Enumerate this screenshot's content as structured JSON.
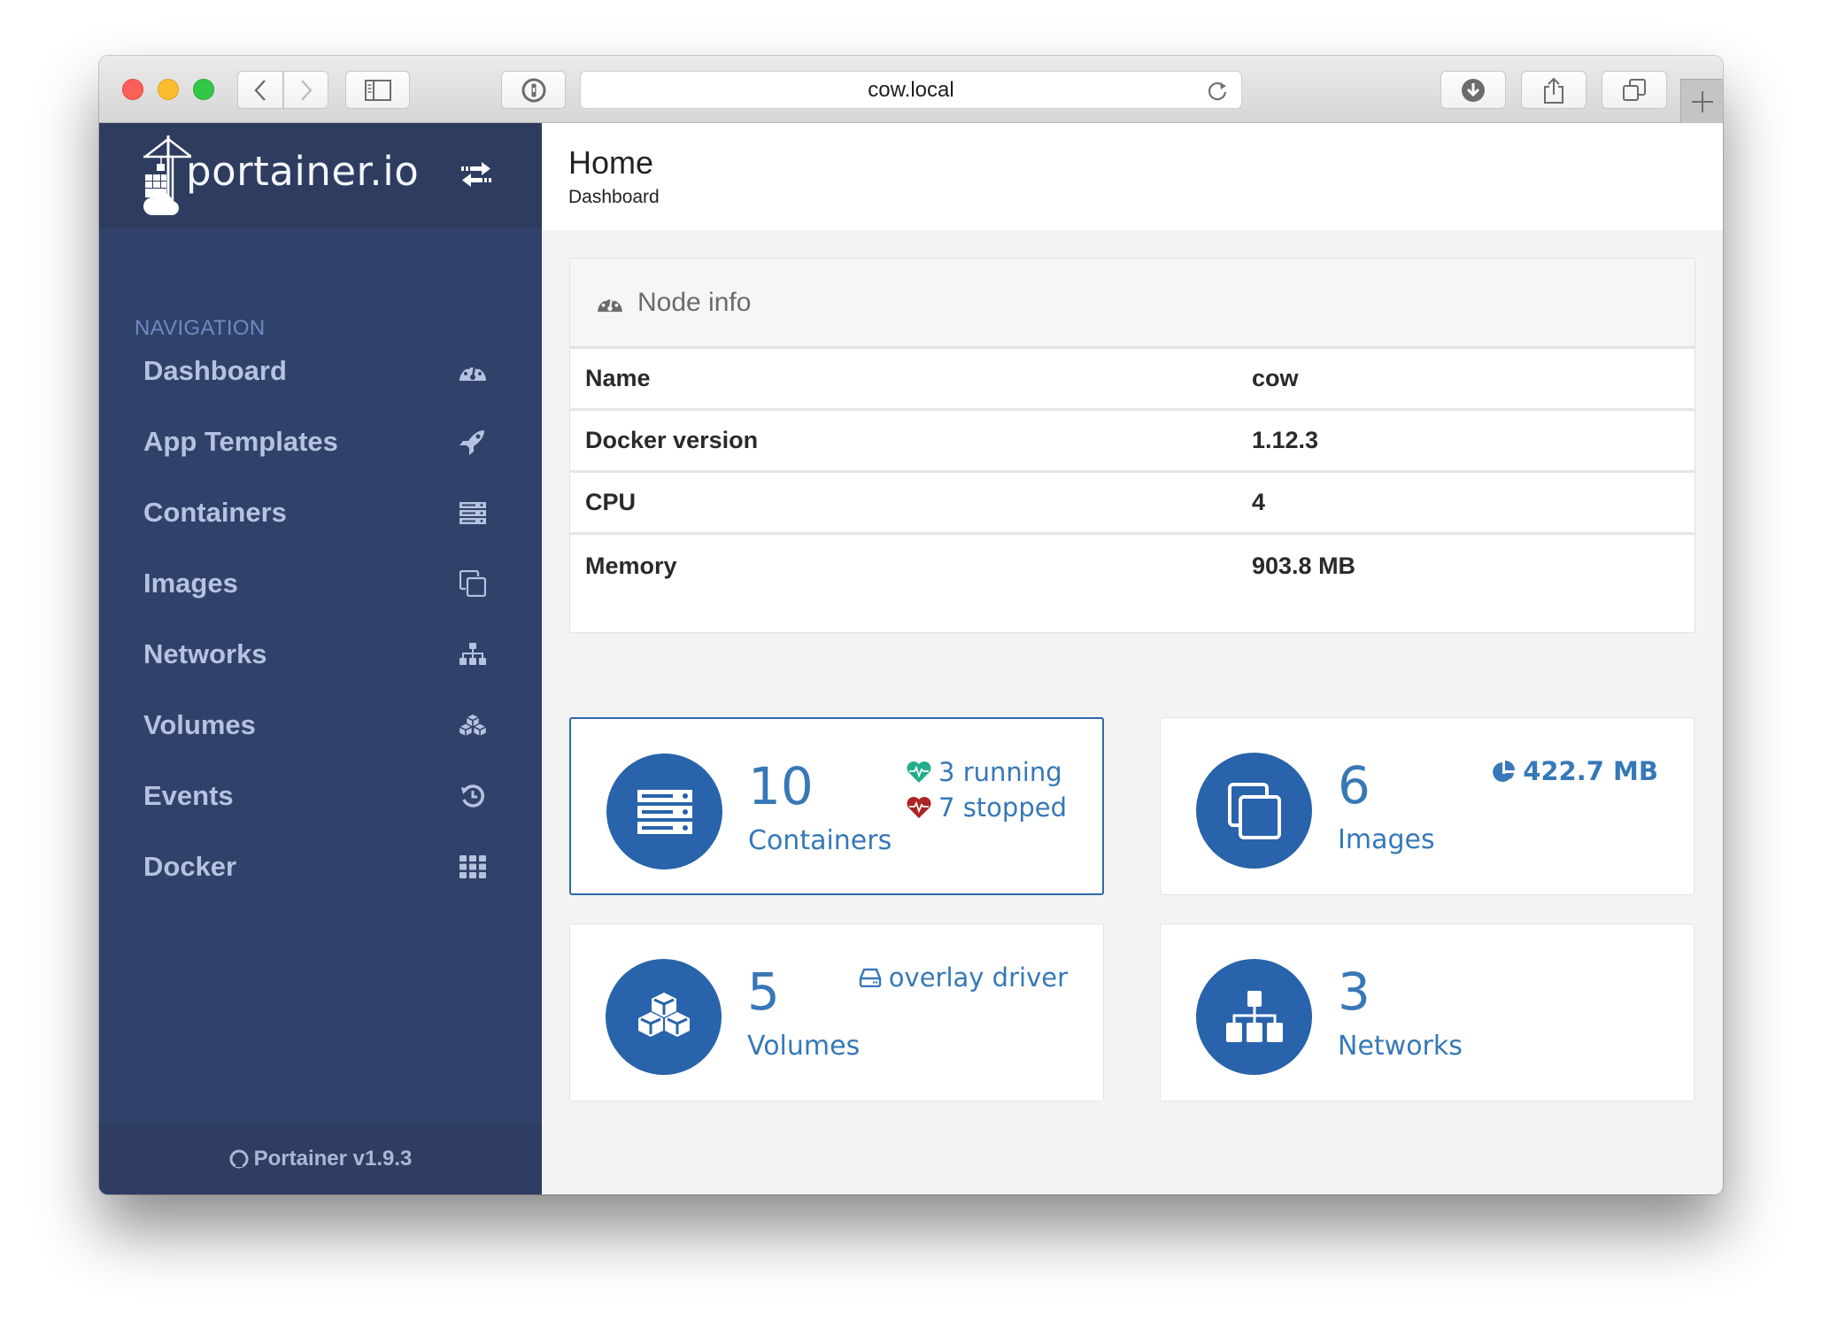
{
  "browser": {
    "url": "cow.local",
    "buttons": {
      "back": "back-button",
      "forward": "forward-button",
      "sidebar": "sidebar-toggle",
      "password": "1password",
      "download": "downloads",
      "share": "share",
      "tabs": "tab-overview",
      "new_tab": "new-tab"
    }
  },
  "brand": {
    "name": "portainer.io"
  },
  "sidebar": {
    "section_title": "NAVIGATION",
    "items": [
      {
        "label": "Dashboard",
        "icon": "dashboard-icon"
      },
      {
        "label": "App Templates",
        "icon": "rocket-icon"
      },
      {
        "label": "Containers",
        "icon": "server-icon"
      },
      {
        "label": "Images",
        "icon": "clone-icon"
      },
      {
        "label": "Networks",
        "icon": "sitemap-icon"
      },
      {
        "label": "Volumes",
        "icon": "cubes-icon"
      },
      {
        "label": "Events",
        "icon": "history-icon"
      },
      {
        "label": "Docker",
        "icon": "th-icon"
      }
    ],
    "footer": "Portainer v1.9.3"
  },
  "header": {
    "title": "Home",
    "subtitle": "Dashboard"
  },
  "node_info": {
    "title": "Node info",
    "rows": [
      {
        "key": "Name",
        "value": "cow"
      },
      {
        "key": "Docker version",
        "value": "1.12.3"
      },
      {
        "key": "CPU",
        "value": "4"
      },
      {
        "key": "Memory",
        "value": "903.8 MB"
      }
    ]
  },
  "cards": {
    "containers": {
      "count": "10",
      "label": "Containers",
      "running": "3 running",
      "stopped": "7 stopped"
    },
    "images": {
      "count": "6",
      "label": "Images",
      "size": "422.7 MB"
    },
    "volumes": {
      "count": "5",
      "label": "Volumes",
      "driver": "overlay driver"
    },
    "networks": {
      "count": "3",
      "label": "Networks"
    }
  },
  "colors": {
    "sidebar_bg": "#30426a",
    "accent": "#2863ab",
    "text_accent": "#3678b8",
    "running": "#23ae89",
    "stopped": "#ae2323"
  }
}
